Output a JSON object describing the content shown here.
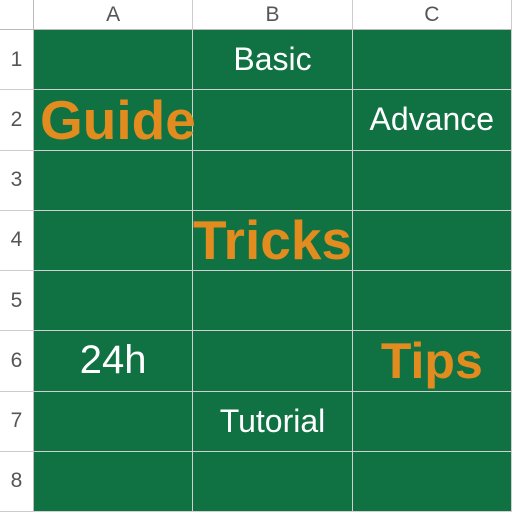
{
  "columns": [
    "A",
    "B",
    "C"
  ],
  "rows": [
    "1",
    "2",
    "3",
    "4",
    "5",
    "6",
    "7",
    "8"
  ],
  "cells": {
    "B1": {
      "text": "Basic",
      "style": "white"
    },
    "A2": {
      "text": "Guide",
      "style": "orange-lg",
      "spread": true
    },
    "C2": {
      "text": "Advance",
      "style": "white"
    },
    "B4": {
      "text": "Tricks",
      "style": "orange-lg",
      "spread": true
    },
    "A6": {
      "text": "24h",
      "style": "white"
    },
    "C6": {
      "text": "Tips",
      "style": "orange-md"
    },
    "B7": {
      "text": "Tutorial",
      "style": "white"
    }
  }
}
